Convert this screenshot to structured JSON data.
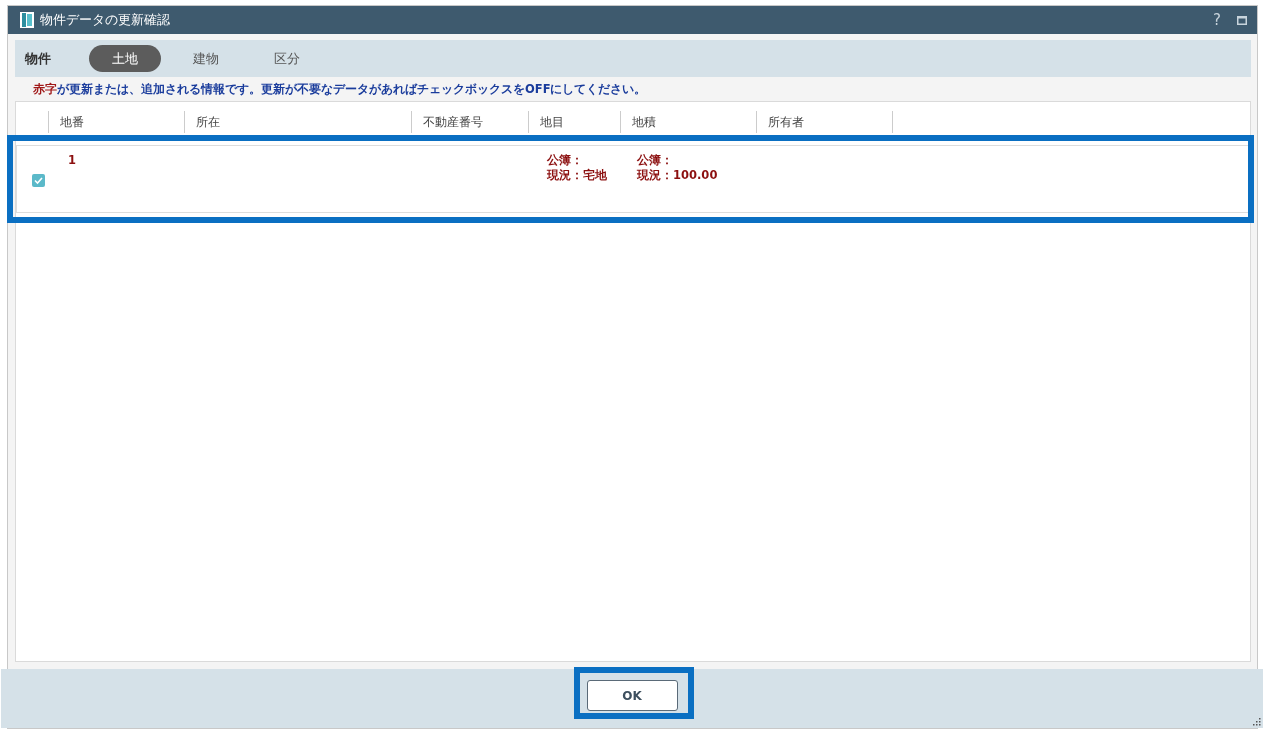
{
  "window": {
    "title": "物件データの更新確認",
    "help": "?"
  },
  "property_bar": {
    "label": "物件",
    "tabs": [
      {
        "label": "土地",
        "selected": true
      },
      {
        "label": "建物",
        "selected": false
      },
      {
        "label": "区分",
        "selected": false
      }
    ]
  },
  "message": [
    {
      "text": "赤字",
      "color": "#a01818"
    },
    {
      "text": "が更新または、追加される情報です。更新が不要なデータがあればチェックボックスをOFFにしてください。",
      "color": "#1a3c9c"
    }
  ],
  "table": {
    "columns": [
      "地番",
      "所在",
      "不動産番号",
      "地目",
      "地積",
      "所有者"
    ],
    "rows": [
      {
        "checked": true,
        "highlighted": true,
        "cells": [
          [
            "1"
          ],
          [],
          [],
          [
            "公簿：",
            "現況：宅地"
          ],
          [
            "公簿：",
            "現況：100.00"
          ],
          []
        ]
      }
    ]
  },
  "ok_button": {
    "label": "OK",
    "highlighted": true
  }
}
